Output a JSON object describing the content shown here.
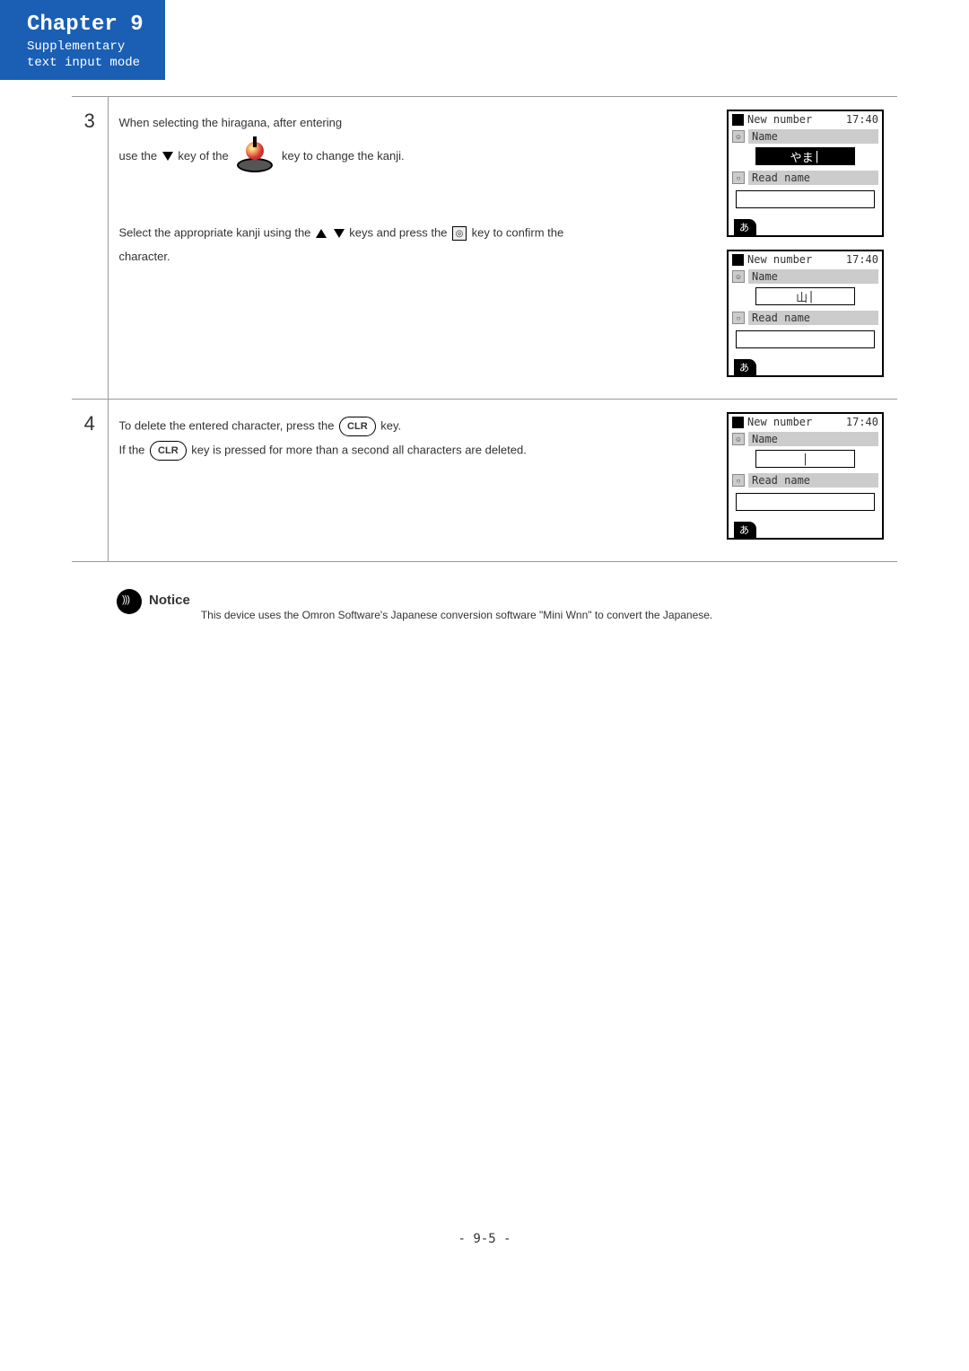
{
  "chapter": {
    "title": "Chapter 9",
    "sub1": "Supplementary",
    "sub2": "text input mode"
  },
  "steps": [
    {
      "num": "3",
      "text": {
        "a1": "When selecting the hiragana, after entering",
        "a2a": "use the ",
        "a2b": " key of the ",
        "a2c": " key to change the kanji.",
        "b1a": "Select the appropriate kanji using the ",
        "b1b": " keys and press the ",
        "b1c": " key to confirm the",
        "b2": "character."
      },
      "shots_labels": {
        "new_number": "New number",
        "time": "17:40",
        "name": "Name",
        "read_name": "Read name",
        "yama_hira": "やま",
        "yama_kanji": "山",
        "cursor": "|",
        "tab": "あ"
      }
    },
    {
      "num": "4",
      "text": {
        "a1a": "To delete the entered character, press the ",
        "clr": "CLR",
        "a1b": " key.",
        "a2a": "If the ",
        "a2b": " key is pressed for more than a second all characters are deleted."
      }
    }
  ],
  "notice": {
    "title": "Notice",
    "text": "This device uses the Omron Software's Japanese conversion software \"Mini Wnn\" to convert the Japanese."
  },
  "ok_glyph": "◎",
  "page_footer": "- 9-5 -"
}
